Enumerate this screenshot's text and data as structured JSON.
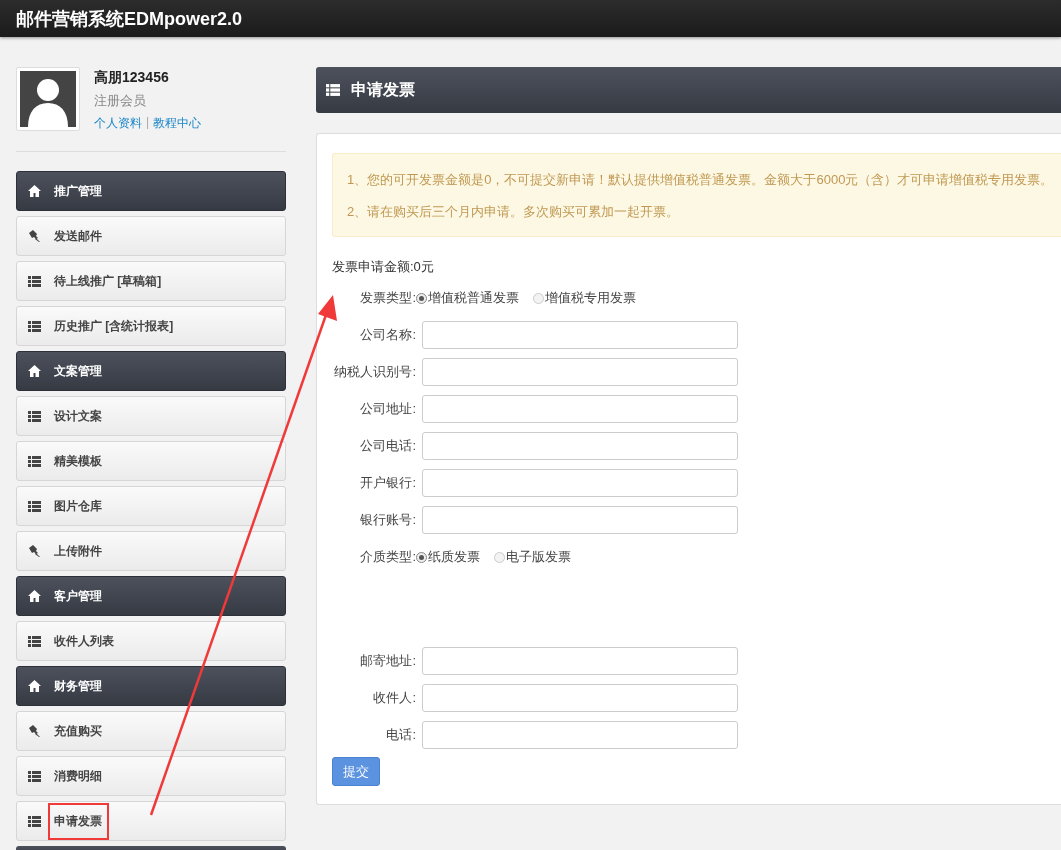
{
  "app": {
    "title": "邮件营销系统EDMpower2.0"
  },
  "profile": {
    "name": "高朋123456",
    "role": "注册会员",
    "links": [
      "个人资料",
      "教程中心"
    ],
    "separator": "|"
  },
  "menu": [
    {
      "kind": "header",
      "label": "推广管理",
      "annotated": false
    },
    {
      "kind": "pin",
      "label": "发送邮件",
      "annotated": false
    },
    {
      "kind": "list",
      "label": "待上线推广 [草稿箱]",
      "annotated": false
    },
    {
      "kind": "list",
      "label": "历史推广 [含统计报表]",
      "annotated": false
    },
    {
      "kind": "header",
      "label": "文案管理",
      "annotated": false
    },
    {
      "kind": "list",
      "label": "设计文案",
      "annotated": false
    },
    {
      "kind": "list",
      "label": "精美模板",
      "annotated": false
    },
    {
      "kind": "list",
      "label": "图片仓库",
      "annotated": false
    },
    {
      "kind": "pin",
      "label": "上传附件",
      "annotated": false
    },
    {
      "kind": "header",
      "label": "客户管理",
      "annotated": false
    },
    {
      "kind": "list",
      "label": "收件人列表",
      "annotated": false
    },
    {
      "kind": "header",
      "label": "财务管理",
      "annotated": false
    },
    {
      "kind": "pin",
      "label": "充值购买",
      "annotated": false
    },
    {
      "kind": "list",
      "label": "消费明细",
      "annotated": false
    },
    {
      "kind": "list",
      "label": "申请发票",
      "annotated": true
    }
  ],
  "main": {
    "title": "申请发票",
    "notices": [
      "1、您的可开发票金额是0，不可提交新申请！默认提供增值税普通发票。金额大于6000元（含）才可申请增值税专用发票。",
      "2、请在购买后三个月内申请。多次购买可累加一起开票。"
    ],
    "amount": "发票申请金额:0元",
    "invoice_fields": [
      {
        "kind": "radio",
        "label": "发票类型:",
        "options": [
          {
            "label": "增值税普通发票",
            "selected": true
          },
          {
            "label": "增值税专用发票",
            "selected": false
          }
        ]
      },
      {
        "kind": "input",
        "label": "公司名称:"
      },
      {
        "kind": "input",
        "label": "纳税人识别号:"
      },
      {
        "kind": "input",
        "label": "公司地址:"
      },
      {
        "kind": "input",
        "label": "公司电话:"
      },
      {
        "kind": "input",
        "label": "开户银行:"
      },
      {
        "kind": "input",
        "label": "银行账号:"
      },
      {
        "kind": "radio",
        "label": "介质类型:",
        "options": [
          {
            "label": "纸质发票",
            "selected": true
          },
          {
            "label": "电子版发票",
            "selected": false
          }
        ]
      }
    ],
    "mailing_fields": [
      {
        "kind": "input",
        "label": "邮寄地址:"
      },
      {
        "kind": "input",
        "label": "收件人:"
      },
      {
        "kind": "input",
        "label": "电话:"
      }
    ],
    "submit": "提交"
  }
}
